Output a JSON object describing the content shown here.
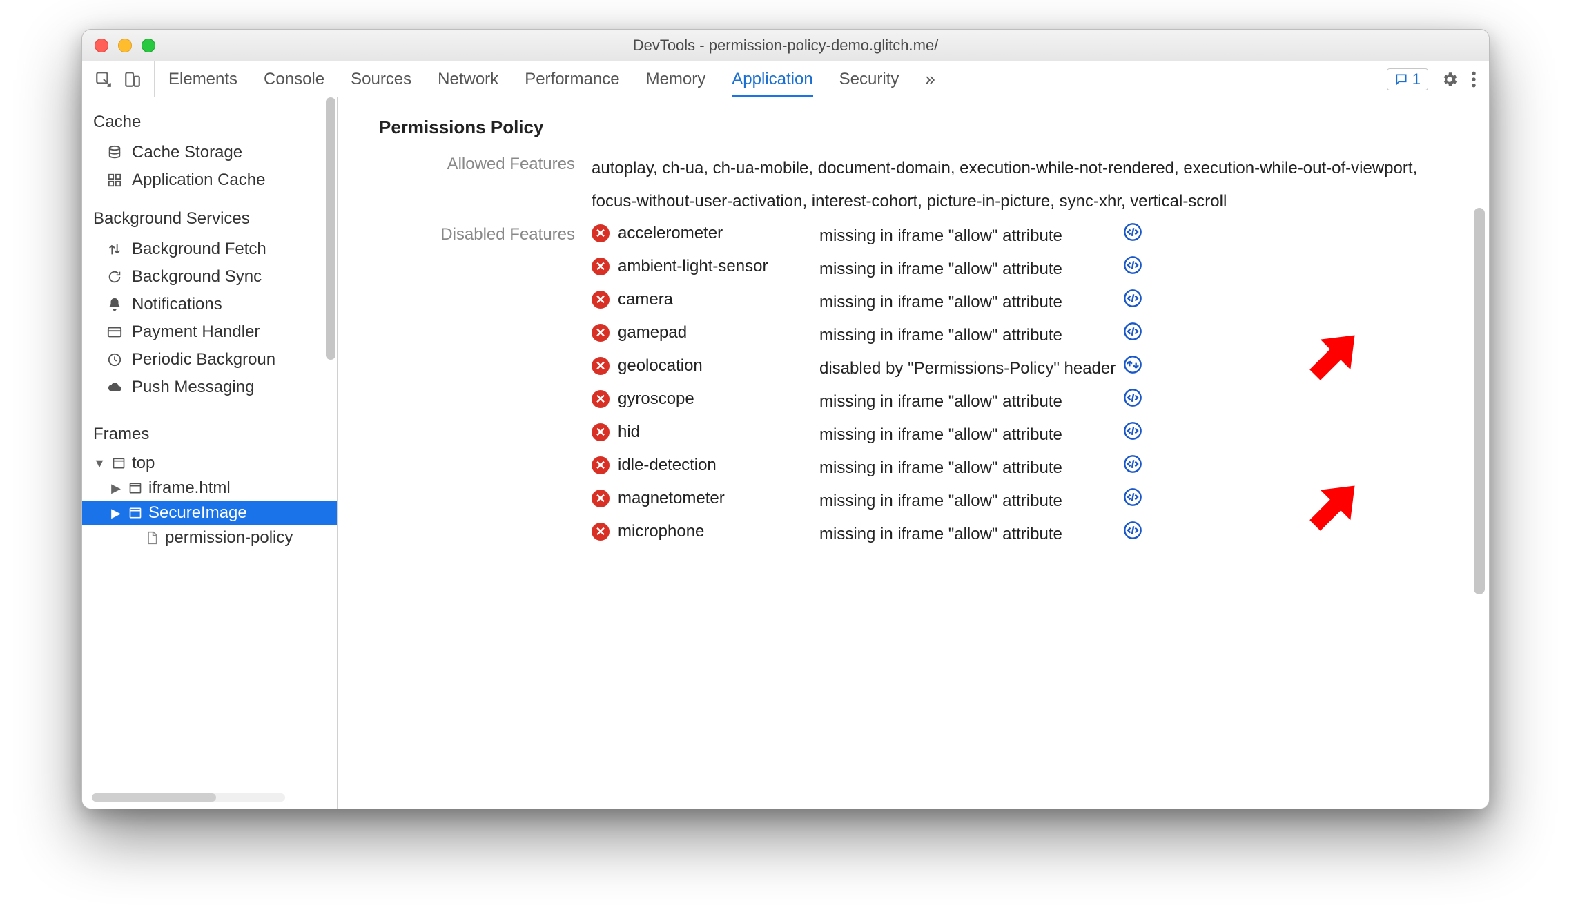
{
  "window": {
    "title": "DevTools - permission-policy-demo.glitch.me/"
  },
  "tabs": {
    "elements": "Elements",
    "console": "Console",
    "sources": "Sources",
    "network": "Network",
    "performance": "Performance",
    "memory": "Memory",
    "application": "Application",
    "security": "Security"
  },
  "issues_badge": {
    "count": "1"
  },
  "sidebar": {
    "cache": {
      "title": "Cache",
      "items": [
        {
          "label": "Cache Storage"
        },
        {
          "label": "Application Cache"
        }
      ]
    },
    "bgservices": {
      "title": "Background Services",
      "items": [
        {
          "label": "Background Fetch"
        },
        {
          "label": "Background Sync"
        },
        {
          "label": "Notifications"
        },
        {
          "label": "Payment Handler"
        },
        {
          "label": "Periodic Backgroun"
        },
        {
          "label": "Push Messaging"
        }
      ]
    },
    "frames": {
      "title": "Frames",
      "top": "top",
      "iframe": "iframe.html",
      "secure": "SecureImage",
      "policy": "permission-policy"
    }
  },
  "panel": {
    "title": "Permissions Policy",
    "allowed_label": "Allowed Features",
    "disabled_label": "Disabled Features",
    "allowed_text": "autoplay, ch-ua, ch-ua-mobile, document-domain, execution-while-not-rendered, execution-while-out-of-viewport, focus-without-user-activation, interest-cohort, picture-in-picture, sync-xhr, vertical-scroll",
    "reason_iframe": "missing in iframe \"allow\" attribute",
    "reason_header": "disabled by \"Permissions-Policy\" header",
    "disabled": [
      {
        "name": "accelerometer",
        "reason_key": "reason_iframe",
        "action": "code"
      },
      {
        "name": "ambient-light-sensor",
        "reason_key": "reason_iframe",
        "action": "code"
      },
      {
        "name": "camera",
        "reason_key": "reason_iframe",
        "action": "code"
      },
      {
        "name": "gamepad",
        "reason_key": "reason_iframe",
        "action": "code"
      },
      {
        "name": "geolocation",
        "reason_key": "reason_header",
        "action": "net"
      },
      {
        "name": "gyroscope",
        "reason_key": "reason_iframe",
        "action": "code"
      },
      {
        "name": "hid",
        "reason_key": "reason_iframe",
        "action": "code"
      },
      {
        "name": "idle-detection",
        "reason_key": "reason_iframe",
        "action": "code"
      },
      {
        "name": "magnetometer",
        "reason_key": "reason_iframe",
        "action": "code"
      },
      {
        "name": "microphone",
        "reason_key": "reason_iframe",
        "action": "code"
      }
    ]
  }
}
